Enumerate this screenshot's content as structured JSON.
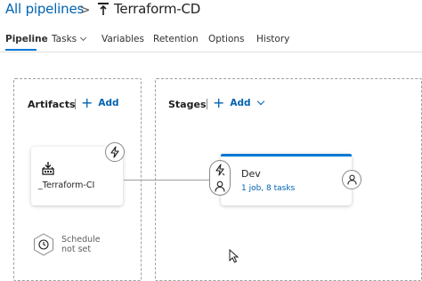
{
  "breadcrumb": {
    "parent": "All pipelines",
    "separator": ">",
    "pipeline_name": "Terraform-CD"
  },
  "tabs": [
    {
      "label": "Pipeline",
      "active": true
    },
    {
      "label": "Tasks",
      "has_dropdown": true
    },
    {
      "label": "Variables"
    },
    {
      "label": "Retention"
    },
    {
      "label": "Options"
    },
    {
      "label": "History"
    }
  ],
  "artifacts": {
    "title": "Artifacts",
    "add_label": "Add",
    "items": [
      {
        "name": "_Terraform-CI",
        "icon": "build-artifact-icon"
      }
    ],
    "trigger_icon": "lightning-icon",
    "schedule": {
      "line1": "Schedule",
      "line2": "not set",
      "icon": "clock-icon"
    }
  },
  "stages": {
    "title": "Stages",
    "add_label": "Add",
    "items": [
      {
        "name": "Dev",
        "summary": "1 job, 8 tasks",
        "pre_icons": [
          "lightning-icon",
          "person-icon"
        ],
        "post_icon": "person-icon"
      }
    ]
  },
  "colors": {
    "accent": "#0078d4",
    "link": "#0063b1",
    "border": "#a19f9d"
  }
}
